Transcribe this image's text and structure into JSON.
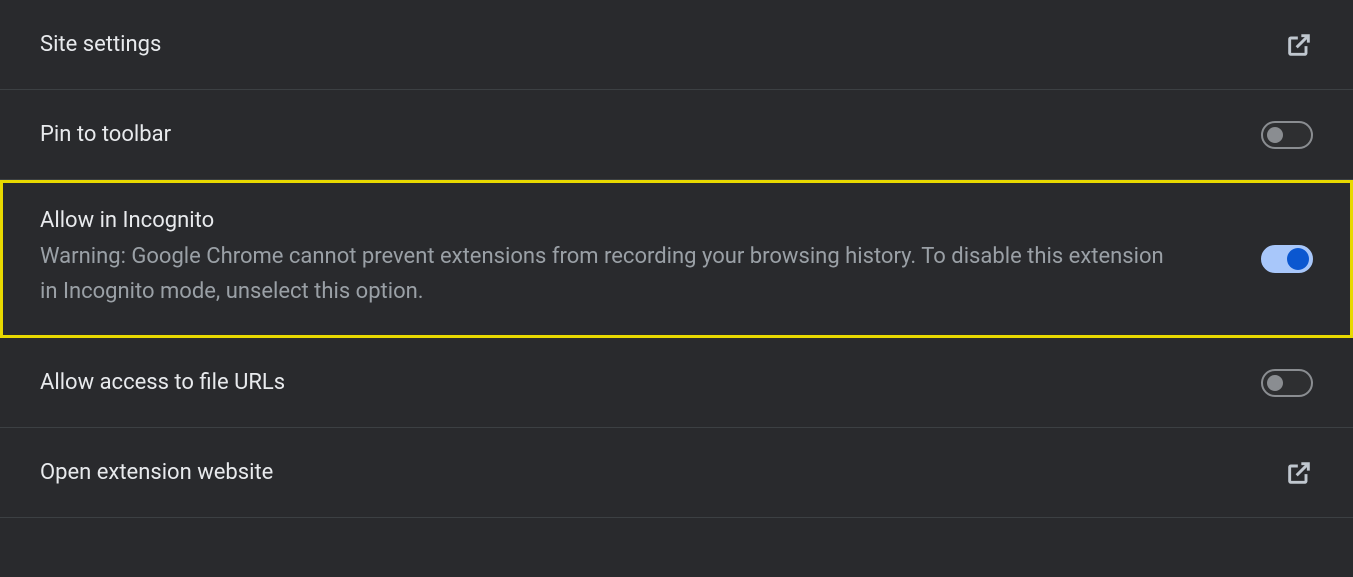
{
  "rows": {
    "site_settings": {
      "title": "Site settings"
    },
    "pin_to_toolbar": {
      "title": "Pin to toolbar",
      "toggled": false
    },
    "allow_incognito": {
      "title": "Allow in Incognito",
      "description": "Warning: Google Chrome cannot prevent extensions from recording your browsing history. To disable this extension in Incognito mode, unselect this option.",
      "toggled": true
    },
    "allow_file_urls": {
      "title": "Allow access to file URLs",
      "toggled": false
    },
    "open_website": {
      "title": "Open extension website"
    }
  }
}
